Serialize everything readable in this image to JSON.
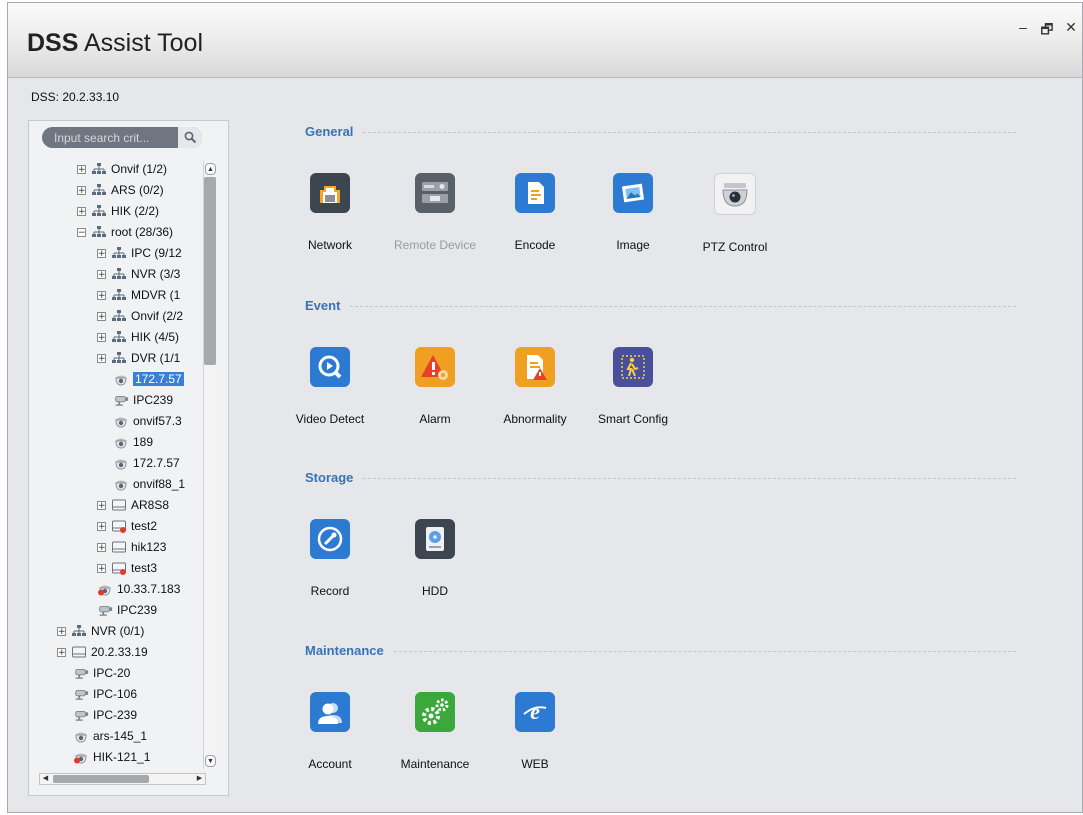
{
  "window": {
    "title_bold": "DSS",
    "title_rest": " Assist Tool",
    "controls": [
      "–",
      "🗗",
      "✕"
    ]
  },
  "server_label": "DSS: 20.2.33.10",
  "search": {
    "placeholder": "Input search crit..."
  },
  "tree": [
    {
      "label": "Onvif (1/2)",
      "type": "group",
      "expander": "+"
    },
    {
      "label": "ARS (0/2)",
      "type": "group",
      "expander": "+"
    },
    {
      "label": "HIK (2/2)",
      "type": "group",
      "expander": "+"
    },
    {
      "label": "root (28/36)",
      "type": "group",
      "expander": "−"
    },
    {
      "label": "IPC (9/12",
      "type": "group",
      "expander": "+"
    },
    {
      "label": "NVR (3/3",
      "type": "group",
      "expander": "+"
    },
    {
      "label": "MDVR (1",
      "type": "group",
      "expander": "+"
    },
    {
      "label": "Onvif (2/2",
      "type": "group",
      "expander": "+"
    },
    {
      "label": "HIK (4/5)",
      "type": "group",
      "expander": "+"
    },
    {
      "label": "DVR (1/1",
      "type": "group",
      "expander": "+"
    },
    {
      "label": "172.7.57",
      "type": "dome",
      "selected": true
    },
    {
      "label": "IPC239",
      "type": "bullet"
    },
    {
      "label": "onvif57.3",
      "type": "dome"
    },
    {
      "label": "189",
      "type": "dome"
    },
    {
      "label": "172.7.57",
      "type": "dome"
    },
    {
      "label": "onvif88_1",
      "type": "dome"
    },
    {
      "label": "AR8S8",
      "type": "dvr",
      "expander": "+"
    },
    {
      "label": "test2",
      "type": "dvr-off",
      "expander": "+"
    },
    {
      "label": "hik123",
      "type": "dvr",
      "expander": "+"
    },
    {
      "label": "test3",
      "type": "dvr-off",
      "expander": "+"
    },
    {
      "label": "10.33.7.183",
      "type": "dome-off"
    },
    {
      "label": "IPC239",
      "type": "bullet"
    },
    {
      "label": "NVR (0/1)",
      "type": "group",
      "expander": "+"
    },
    {
      "label": "20.2.33.19",
      "type": "dvr",
      "expander": "+"
    },
    {
      "label": "IPC-20",
      "type": "bullet"
    },
    {
      "label": "IPC-106",
      "type": "bullet"
    },
    {
      "label": "IPC-239",
      "type": "bullet"
    },
    {
      "label": "ars-145_1",
      "type": "dome"
    },
    {
      "label": "HIK-121_1",
      "type": "dome-off"
    }
  ],
  "sections": [
    {
      "title": "General",
      "items": [
        {
          "label": "Network",
          "icon": "network-icon",
          "color": "#3d4650"
        },
        {
          "label": "Remote Device",
          "icon": "remote-device-icon",
          "color": "#5a6068",
          "disabled": true
        },
        {
          "label": "Encode",
          "icon": "encode-icon",
          "color": "#2c7ad2"
        },
        {
          "label": "Image",
          "icon": "image-icon",
          "color": "#2c7ad2"
        },
        {
          "label": "PTZ Control",
          "icon": "ptz-camera-icon",
          "color": "#f2f2f2"
        }
      ]
    },
    {
      "title": "Event",
      "items": [
        {
          "label": "Video Detect",
          "icon": "video-detect-icon",
          "color": "#2c7ad2"
        },
        {
          "label": "Alarm",
          "icon": "alarm-icon",
          "color": "#f0a020"
        },
        {
          "label": "Abnormality",
          "icon": "abnormality-icon",
          "color": "#f0a020"
        },
        {
          "label": "Smart Config",
          "icon": "smart-config-icon",
          "color": "#4a4f9c"
        }
      ]
    },
    {
      "title": "Storage",
      "items": [
        {
          "label": "Record",
          "icon": "record-icon",
          "color": "#2c7ad2"
        },
        {
          "label": "HDD",
          "icon": "hdd-icon",
          "color": "#3d4650"
        }
      ]
    },
    {
      "title": "Maintenance",
      "items": [
        {
          "label": "Account",
          "icon": "account-icon",
          "color": "#2c7ad2"
        },
        {
          "label": "Maintenance",
          "icon": "maintenance-icon",
          "color": "#3aa83a"
        },
        {
          "label": "WEB",
          "icon": "web-icon",
          "color": "#2c7ad2"
        }
      ]
    }
  ]
}
